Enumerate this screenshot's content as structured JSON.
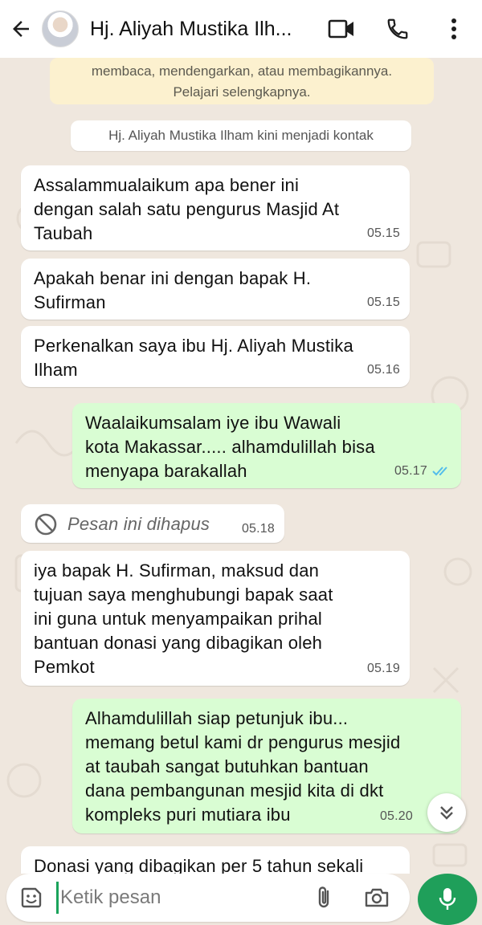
{
  "header": {
    "contact_name": "Hj. Aliyah Mustika Ilh...",
    "icons": [
      "back-arrow-icon",
      "avatar",
      "video-call-icon",
      "voice-call-icon",
      "more-options-icon"
    ]
  },
  "chat": {
    "system_note": {
      "line1": "membaca, mendengarkan, atau membagikannya.",
      "line2": "Pelajari selengkapnya."
    },
    "contact_note": "Hj. Aliyah Mustika Ilham kini menjadi kontak",
    "messages": [
      {
        "direction": "in",
        "text": "Assalammualaikum apa bener ini\ndengan salah satu pengurus Masjid At\nTaubah",
        "time": "05.15"
      },
      {
        "direction": "in",
        "text": "Apakah benar ini dengan bapak H.\nSufirman",
        "time": "05.15"
      },
      {
        "direction": "in",
        "text": "Perkenalkan saya ibu Hj. Aliyah Mustika\nIlham",
        "time": "05.16"
      },
      {
        "direction": "out",
        "text": "Waalaikumsalam iye ibu Wawali\nkota Makassar..... alhamdulillah bisa\nmenyapa barakallah",
        "time": "05.17",
        "status": "read"
      },
      {
        "direction": "in",
        "deleted": true,
        "text": "Pesan ini dihapus",
        "time": "05.18"
      },
      {
        "direction": "in",
        "text": "iya bapak H. Sufirman, maksud dan\ntujuan saya menghubungi bapak saat\nini guna untuk menyampaikan prihal\nbantuan donasi yang dibagikan oleh\nPemkot",
        "time": "05.19"
      },
      {
        "direction": "out",
        "text": "Alhamdulillah siap petunjuk ibu...\nmemang betul kami dr pengurus mesjid\nat taubah sangat butuhkan bantuan\ndana pembangunan mesjid kita di dkt\nkompleks puri mutiara ibu",
        "time": "05.20",
        "status": "read"
      },
      {
        "direction": "in",
        "text": "Donasi yang dibagikan per 5 tahun sekali",
        "time": ""
      }
    ]
  },
  "composer": {
    "placeholder": "Ketik pesan",
    "icons": [
      "emoji-icon",
      "attach-icon",
      "camera-icon",
      "mic-icon"
    ]
  },
  "colors": {
    "chat_bg": "#efe7de",
    "incoming_bubble": "#ffffff",
    "outgoing_bubble": "#d9fdd3",
    "read_tick": "#53bdeb",
    "accent_green": "#1f9f5a",
    "system_note_bg": "#fcf1cf"
  }
}
